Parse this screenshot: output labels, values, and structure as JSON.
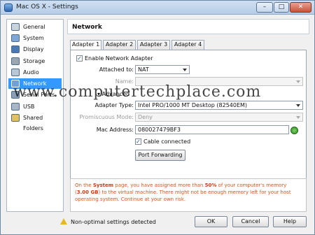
{
  "window": {
    "title": "Mac OS X - Settings"
  },
  "sidebar": {
    "items": [
      {
        "label": "General",
        "icon": "gear-icon"
      },
      {
        "label": "System",
        "icon": "chip-icon"
      },
      {
        "label": "Display",
        "icon": "monitor-icon"
      },
      {
        "label": "Storage",
        "icon": "disk-icon"
      },
      {
        "label": "Audio",
        "icon": "speaker-icon"
      },
      {
        "label": "Network",
        "icon": "network-icon"
      },
      {
        "label": "Serial Ports",
        "icon": "serial-port-icon"
      },
      {
        "label": "USB",
        "icon": "usb-icon"
      },
      {
        "label": "Shared Folders",
        "icon": "folder-icon"
      }
    ],
    "selected": "Network"
  },
  "panel": {
    "title": "Network",
    "tabs": [
      "Adapter 1",
      "Adapter 2",
      "Adapter 3",
      "Adapter 4"
    ],
    "active_tab": "Adapter 1",
    "enable_label": "Enable Network Adapter",
    "enable_checked": true,
    "attached_label": "Attached to:",
    "attached_value": "NAT",
    "name_label": "Name:",
    "name_value": "",
    "advanced_label": "Advanced",
    "adapter_type_label": "Adapter Type:",
    "adapter_type_value": "Intel PRO/1000 MT Desktop (82540EM)",
    "promiscuous_label": "Promiscuous Mode:",
    "promiscuous_value": "Deny",
    "mac_label": "Mac Address:",
    "mac_value": "080027479BF3",
    "cable_label": "Cable connected",
    "cable_checked": true,
    "port_forwarding_label": "Port Forwarding"
  },
  "warning": {
    "part1": "On the ",
    "system": "System",
    "part2": " page, you have assigned more than ",
    "percent": "50%",
    "part3": " of your computer's memory (",
    "memory": "3.00 GB",
    "part4": ") to the virtual machine. There might not be enough memory left for your host operating system. Continue at your own risk."
  },
  "footer": {
    "status": "Non-optimal settings detected",
    "ok": "OK",
    "cancel": "Cancel",
    "help": "Help"
  },
  "watermark": "www.computertechplace.com",
  "colors": {
    "selection": "#3399ff",
    "warning_text": "#d9541b"
  }
}
